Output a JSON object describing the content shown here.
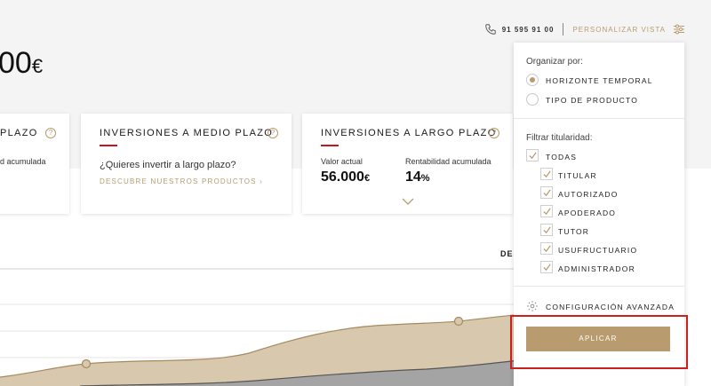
{
  "header": {
    "phone_number": "91 595 91 00",
    "personalizar_label": "PERSONALIZAR VISTA"
  },
  "summary": {
    "total_value": "00",
    "currency": "€"
  },
  "cards": {
    "short_term": {
      "title": "PLAZO",
      "sub_label": "d acumulada"
    },
    "medium_term": {
      "title": "INVERSIONES A MEDIO PLAZO",
      "question": "¿Quieres invertir a largo plazo?",
      "link": "DESCUBRE NUESTROS PRODUCTOS  ›"
    },
    "long_term": {
      "title": "INVERSIONES A LARGO PLAZO",
      "valor_label": "Valor actual",
      "valor_amount": "56.000",
      "valor_unit": "€",
      "rent_label": "Rentabilidad acumulada",
      "rent_amount": "14",
      "rent_unit": "%"
    }
  },
  "chart": {
    "header_fragment": "DES"
  },
  "panel": {
    "organize_label": "Organizar por:",
    "organize_options": [
      {
        "label": "HORIZONTE TEMPORAL",
        "selected": true
      },
      {
        "label": "TIPO DE PRODUCTO",
        "selected": false
      }
    ],
    "filter_label": "Filtrar titularidad:",
    "filter_all": {
      "label": "TODAS",
      "checked": true
    },
    "filter_options": [
      {
        "label": "TITULAR",
        "checked": true
      },
      {
        "label": "AUTORIZADO",
        "checked": true
      },
      {
        "label": "APODERADO",
        "checked": true
      },
      {
        "label": "TUTOR",
        "checked": true
      },
      {
        "label": "USUFRUCTUARIO",
        "checked": true
      },
      {
        "label": "ADMINISTRADOR",
        "checked": true
      }
    ],
    "advanced_label": "CONFIGURACIÓN AVANZADA",
    "apply_label": "APLICAR"
  },
  "colors": {
    "accent": "#b89b6e",
    "brand_red": "#c4161c",
    "highlight": "#cc1f1f"
  }
}
